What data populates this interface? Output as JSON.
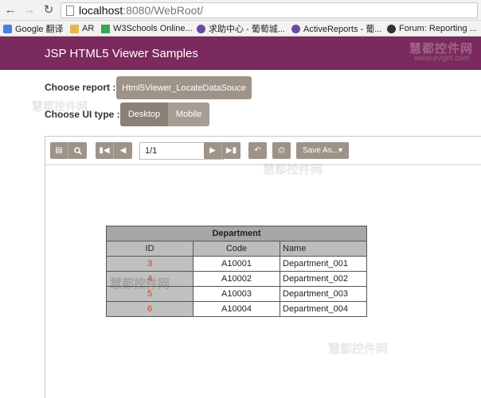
{
  "browser": {
    "url_host": "localhost",
    "url_path": ":8080/WebRoot/",
    "bookmarks": [
      {
        "label": "Google 翻译",
        "icon": "google-translate-icon",
        "color": "#4a7ee8"
      },
      {
        "label": "AR",
        "icon": "folder-icon",
        "color": "#e8b54a"
      },
      {
        "label": "W3Schools Online...",
        "icon": "w3schools-icon",
        "color": "#3aa54a"
      },
      {
        "label": "求助中心 - 葡萄城...",
        "icon": "grapecity-icon",
        "color": "#6a4aa8"
      },
      {
        "label": "ActiveReports - 葡...",
        "icon": "activereports-icon",
        "color": "#6a4aa8"
      },
      {
        "label": "Forum: Reporting ...",
        "icon": "forum-icon",
        "color": "#333333"
      }
    ]
  },
  "header": {
    "title": "JSP HTML5 Viewer Samples",
    "watermark": "慧都控件网",
    "watermark_url": "www.evget.com",
    "color": "#7a2a5c"
  },
  "controls": {
    "choose_report_label": "Choose report :",
    "report_value": "Html5Viewer_LocateDataSouce",
    "choose_ui_label": "Choose UI type :",
    "ui_desktop": "Desktop",
    "ui_mobile": "Mobile"
  },
  "toolbar": {
    "page_value": "1/1",
    "save_as": "Save As..."
  },
  "report": {
    "title": "Department",
    "headers": [
      "ID",
      "Code",
      "Name"
    ],
    "rows": [
      [
        "3",
        "A10001",
        "Department_001"
      ],
      [
        "4",
        "A10002",
        "Department_002"
      ],
      [
        "5",
        "A10003",
        "Department_003"
      ],
      [
        "6",
        "A10004",
        "Department_004"
      ]
    ]
  },
  "watermarks": [
    "慧都控件网",
    "慧都控件网",
    "慧都控件网",
    "慧都控件网"
  ]
}
